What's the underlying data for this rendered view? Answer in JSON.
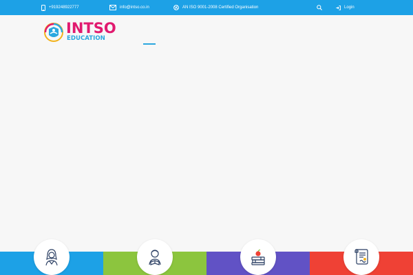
{
  "topbar": {
    "phone": {
      "icon": "mobile-phone-icon",
      "text": "+919248922777"
    },
    "email": {
      "icon": "envelope-icon",
      "text": "info@intso.co.in"
    },
    "iso": {
      "icon": "globe-icon",
      "text": "AN ISO 9001-2008 Certified Organisation"
    },
    "search": {
      "icon": "search-icon"
    },
    "login": {
      "icon": "sign-in-icon",
      "text": "Login"
    }
  },
  "logo": {
    "word": "INTSO",
    "sub": "EDUCATION",
    "emblem_text": "INTSO Education"
  },
  "colors": {
    "topbar": "#1da1e6",
    "brand_pink": "#e11a6f",
    "brand_blue": "#2aa7df",
    "band_blue": "#1da1e6",
    "band_green": "#8cc53e",
    "band_purple": "#6152c5",
    "band_red": "#ef4135"
  },
  "features": [
    {
      "icon": "student-girl-icon",
      "color": "#1da1e6"
    },
    {
      "icon": "student-reading-icon",
      "color": "#8cc53e"
    },
    {
      "icon": "books-apple-icon",
      "color": "#6152c5"
    },
    {
      "icon": "certificate-scroll-icon",
      "color": "#ef4135"
    }
  ]
}
